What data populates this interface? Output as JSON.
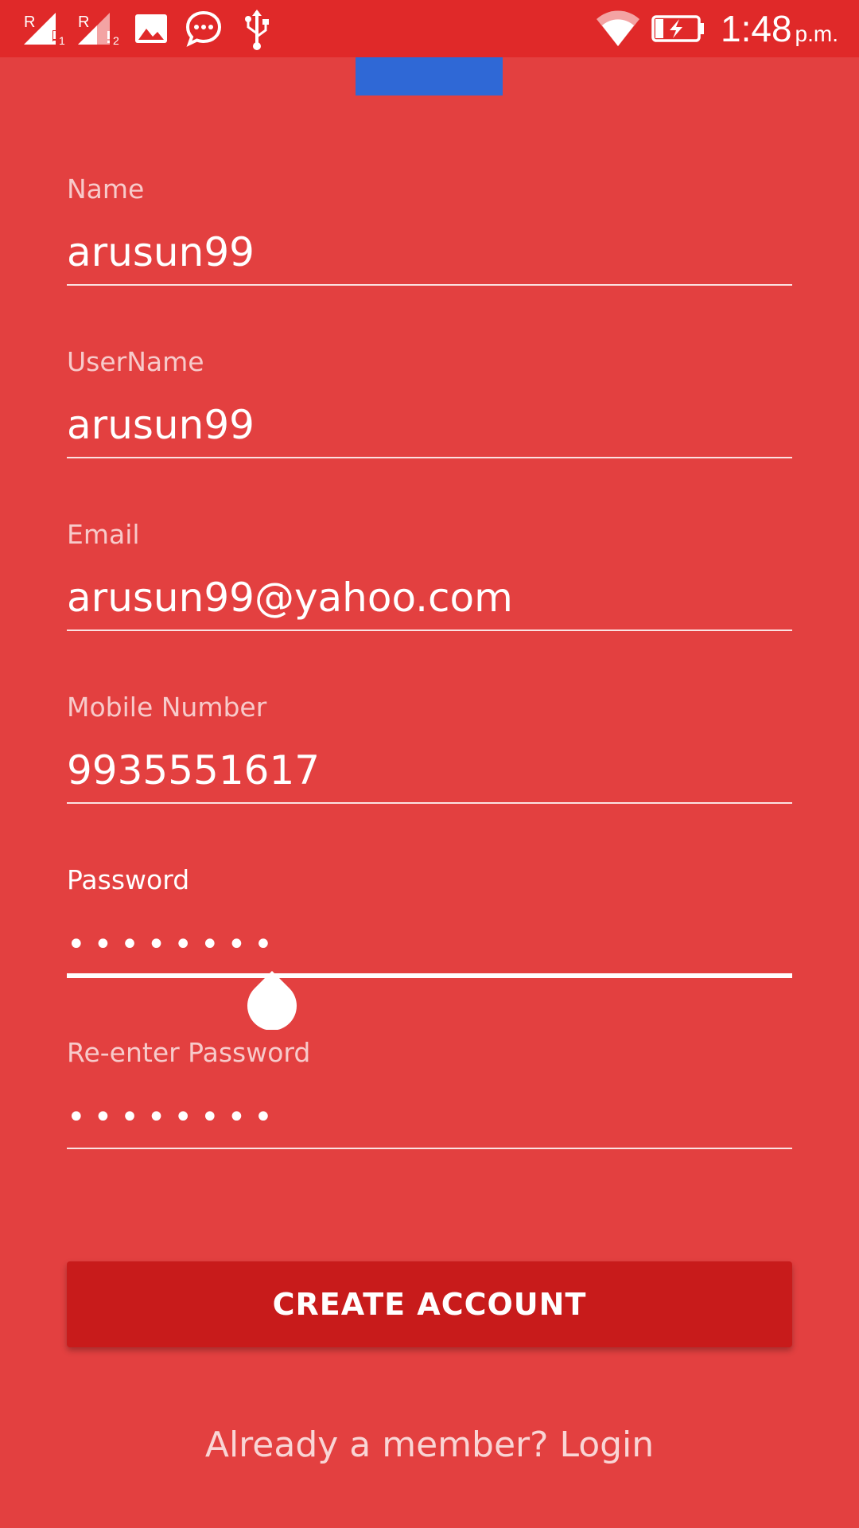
{
  "status_bar": {
    "time": "1:48",
    "ampm": "p.m.",
    "icons": [
      "signal-sim1-icon",
      "signal-sim2-icon",
      "gallery-icon",
      "message-icon",
      "usb-icon",
      "wifi-icon",
      "battery-charging-icon"
    ],
    "sim1_label": "R",
    "sim2_label": "R",
    "sim1_index": "1",
    "sim2_index": "2"
  },
  "form": {
    "name": {
      "label": "Name",
      "value": "arusun99"
    },
    "username": {
      "label": "UserName",
      "value": "arusun99"
    },
    "email": {
      "label": "Email",
      "value": "arusun99@yahoo.com"
    },
    "mobile": {
      "label": "Mobile Number",
      "value": "9935551617"
    },
    "password": {
      "label": "Password",
      "value": "••••••••"
    },
    "reenter_password": {
      "label": "Re-enter Password",
      "value": "••••••••"
    }
  },
  "actions": {
    "create_account": "CREATE ACCOUNT",
    "login_link": "Already a member? Login"
  },
  "colors": {
    "background": "#e34040",
    "status_bar": "#e02929",
    "button": "#c81b1b",
    "top_block": "#2f68d6"
  }
}
